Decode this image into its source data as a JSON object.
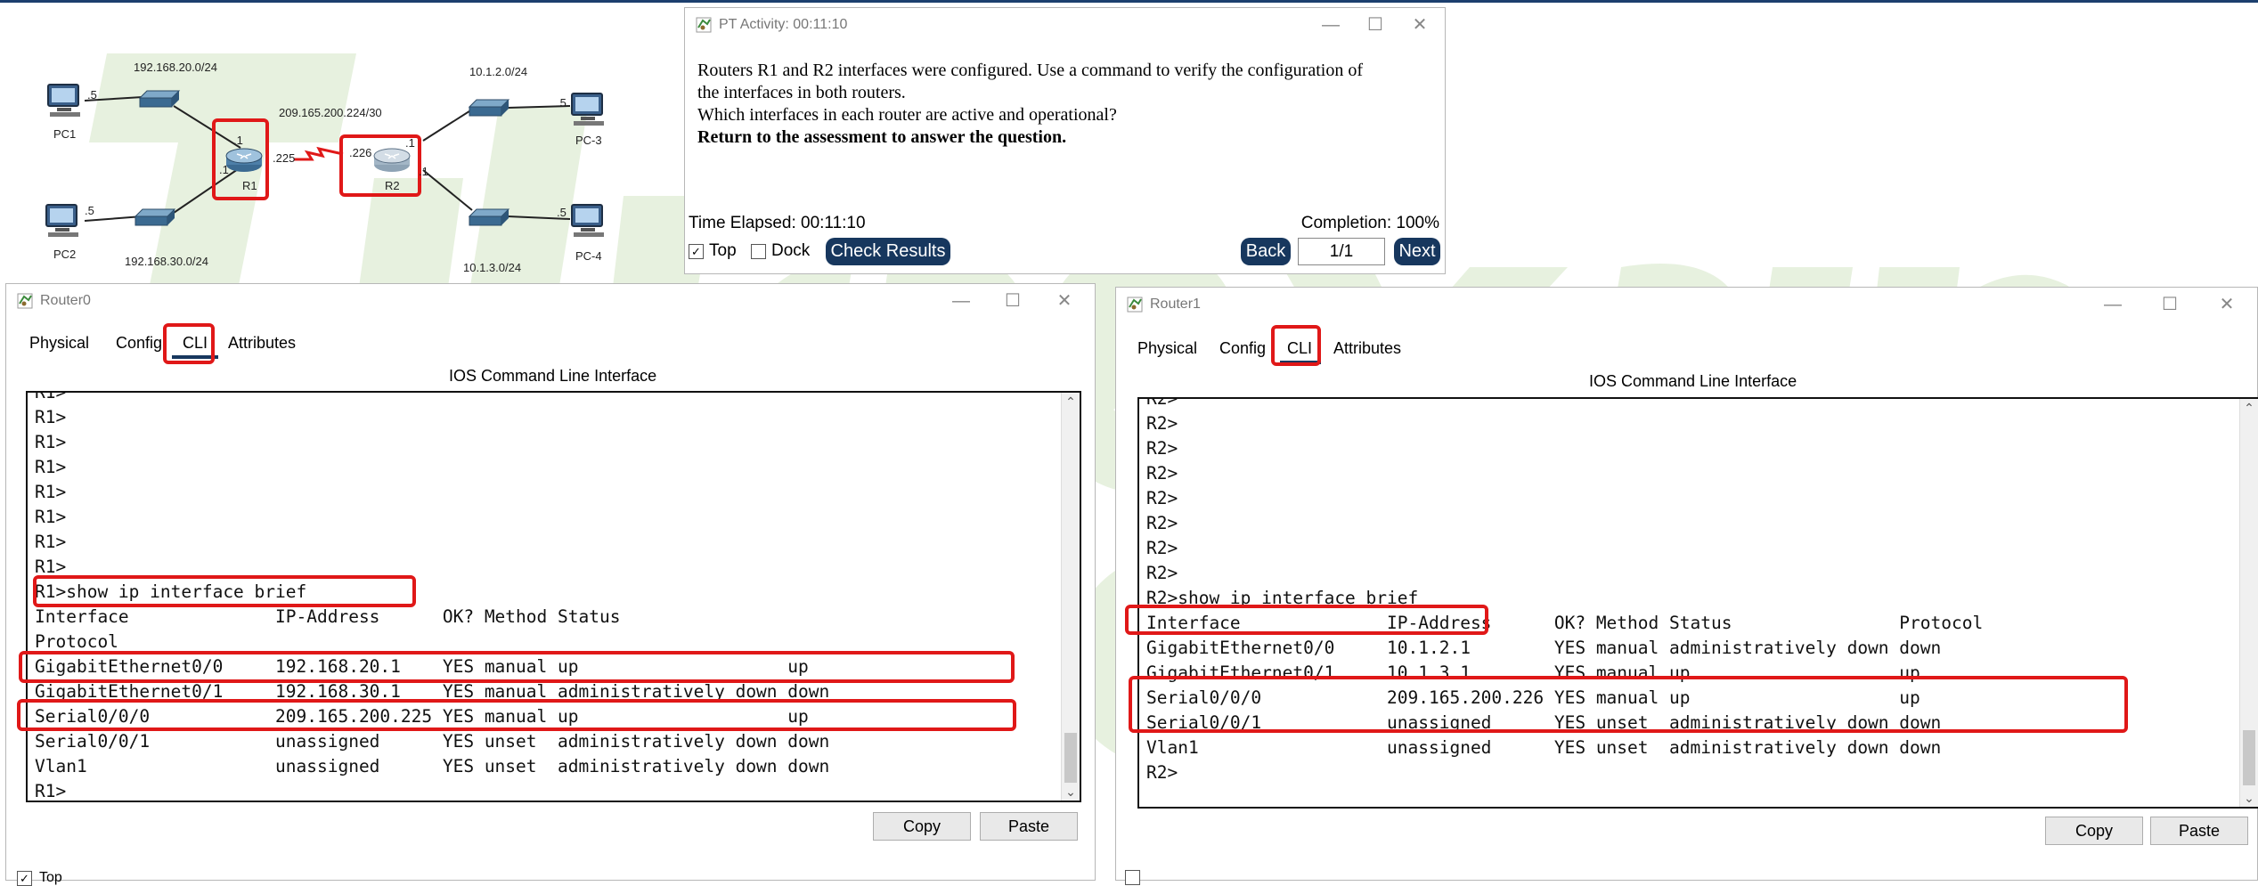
{
  "topology": {
    "net_pc1_lan": "192.168.20.0/24",
    "net_pc2_lan": "192.168.30.0/24",
    "net_serial": "209.165.200.224/30",
    "net_pc3_lan": "10.1.2.0/24",
    "net_pc4_lan": "10.1.3.0/24",
    "pc1": "PC1",
    "pc2": "PC2",
    "pc3": "PC-3",
    "pc4": "PC-4",
    "r1": "R1",
    "r2": "R2",
    "host_pc1": ".5",
    "host_pc2": ".5",
    "host_pc3": ".5",
    "host_pc4": ".5",
    "r1_up": ".1",
    "r1_down": ".1",
    "r1_serial": ".225",
    "r2_serial": ".226",
    "r2_up": ".1",
    "r2_down": ".1"
  },
  "activity": {
    "title": "PT Activity: 00:11:10",
    "line1": "Routers R1 and R2 interfaces were configured. Use a command to verify the configuration of",
    "line2": "the interfaces in both routers.",
    "line3": "Which interfaces in each router are active and operational?",
    "line4": "Return to the assessment to answer the question.",
    "elapsed": "Time Elapsed: 00:11:10",
    "completion": "Completion: 100%",
    "top_label": "Top",
    "dock_label": "Dock",
    "check_results": "Check Results",
    "back": "Back",
    "page": "1/1",
    "next": "Next"
  },
  "router0": {
    "title": "Router0",
    "tabs": [
      "Physical",
      "Config",
      "CLI",
      "Attributes"
    ],
    "ios_title": "IOS Command Line Interface",
    "console_text": "R1>\nR1>\nR1>\nR1>\nR1>\nR1>\nR1>\nR1>\nR1>show ip interface brief\nInterface              IP-Address      OK? Method Status\nProtocol\nGigabitEthernet0/0     192.168.20.1    YES manual up                    up\nGigabitEthernet0/1     192.168.30.1    YES manual administratively down down\nSerial0/0/0            209.165.200.225 YES manual up                    up\nSerial0/0/1            unassigned      YES unset  administratively down down\nVlan1                  unassigned      YES unset  administratively down down\nR1>",
    "copy": "Copy",
    "paste": "Paste",
    "top_label": "Top"
  },
  "router1": {
    "title": "Router1",
    "tabs": [
      "Physical",
      "Config",
      "CLI",
      "Attributes"
    ],
    "ios_title": "IOS Command Line Interface",
    "console_text": "R2>\nR2>\nR2>\nR2>\nR2>\nR2>\nR2>\nR2>\nR2>show ip interface brief\nInterface              IP-Address      OK? Method Status                Protocol\nGigabitEthernet0/0     10.1.2.1        YES manual administratively down down\nGigabitEthernet0/1     10.1.3.1        YES manual up                    up\nSerial0/0/0            209.165.200.226 YES manual up                    up\nSerial0/0/1            unassigned      YES unset  administratively down down\nVlan1                  unassigned      YES unset  administratively down down\nR2>",
    "copy": "Copy",
    "paste": "Paste"
  },
  "colors": {
    "highlight": "#e01818",
    "button_dark": "#17375e",
    "watermark": "#e7f1df"
  },
  "icons": {
    "pc": "pc-icon",
    "switch": "switch-icon",
    "router": "router-icon",
    "packet_tracer": "packet-tracer-icon"
  }
}
